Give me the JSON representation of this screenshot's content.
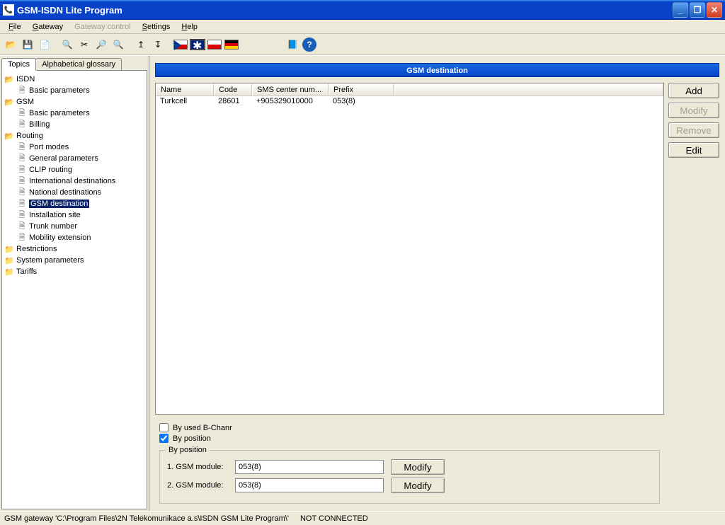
{
  "window": {
    "title": "GSM-ISDN Lite Program"
  },
  "menu": {
    "file": "File",
    "gateway": "Gateway",
    "gateway_control": "Gateway control",
    "settings": "Settings",
    "help": "Help"
  },
  "tabs": {
    "topics": "Topics",
    "glossary": "Alphabetical glossary"
  },
  "tree": {
    "isdn": "ISDN",
    "isdn_basic": "Basic parameters",
    "gsm": "GSM",
    "gsm_basic": "Basic parameters",
    "gsm_billing": "Billing",
    "routing": "Routing",
    "port_modes": "Port modes",
    "general_params": "General parameters",
    "clip_routing": "CLIP routing",
    "intl_dest": "International destinations",
    "nat_dest": "National destinations",
    "gsm_dest": "GSM destination",
    "install_site": "Installation site",
    "trunk_number": "Trunk number",
    "mobility_ext": "Mobility extension",
    "restrictions": "Restrictions",
    "sys_params": "System parameters",
    "tariffs": "Tariffs"
  },
  "panel": {
    "title": "GSM destination"
  },
  "table": {
    "headers": {
      "name": "Name",
      "code": "Code",
      "sms": "SMS center num...",
      "prefix": "Prefix"
    },
    "rows": [
      {
        "name": "Turkcell",
        "code": "28601",
        "sms": "+905329010000",
        "prefix": "053(8)"
      }
    ]
  },
  "buttons": {
    "add": "Add",
    "modify": "Modify",
    "remove": "Remove",
    "edit": "Edit"
  },
  "filters": {
    "by_bchan": "By used B-Chanr",
    "by_position": "By position"
  },
  "group": {
    "legend": "By position",
    "row1_label": "1. GSM module:",
    "row1_value": "053(8)",
    "row2_label": "2. GSM module:",
    "row2_value": "053(8)",
    "modify": "Modify"
  },
  "status": {
    "path": "GSM gateway 'C:\\Program Files\\2N Telekomunikace a.s\\ISDN GSM Lite Program\\'",
    "conn": "NOT CONNECTED"
  }
}
